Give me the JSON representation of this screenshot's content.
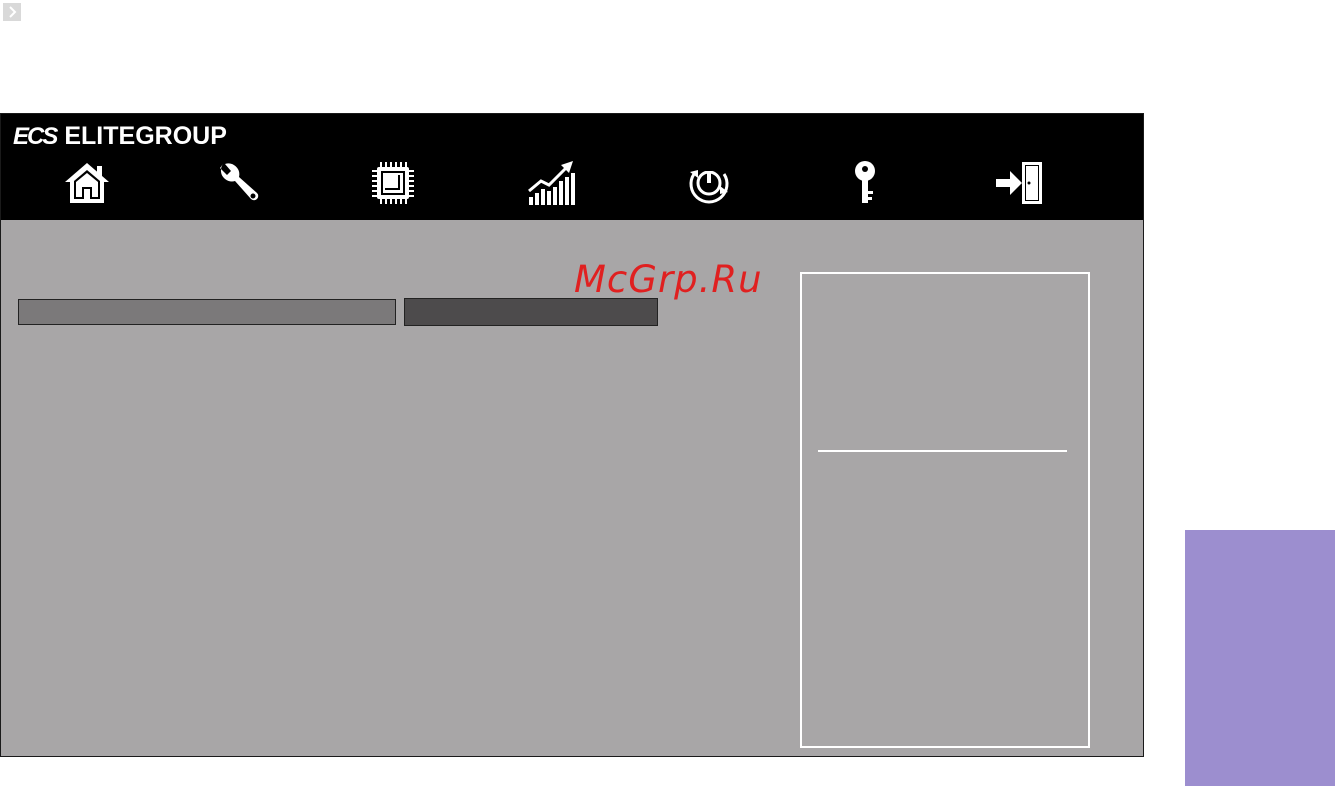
{
  "brand": {
    "logo_mark": "ECS",
    "name": "ELITEGROUP"
  },
  "nav": {
    "items": [
      {
        "icon": "home-icon"
      },
      {
        "icon": "wrench-icon"
      },
      {
        "icon": "chip-icon"
      },
      {
        "icon": "performance-chart-icon"
      },
      {
        "icon": "power-icon"
      },
      {
        "icon": "key-icon"
      },
      {
        "icon": "exit-icon"
      }
    ]
  },
  "watermark": "McGrp.Ru",
  "colors": {
    "header": "#000000",
    "body": "#a8a6a7",
    "field_left": "#7b797a",
    "field_right": "#4d4b4c",
    "side_tab": "#9c8ecf",
    "watermark": "#e02020"
  }
}
